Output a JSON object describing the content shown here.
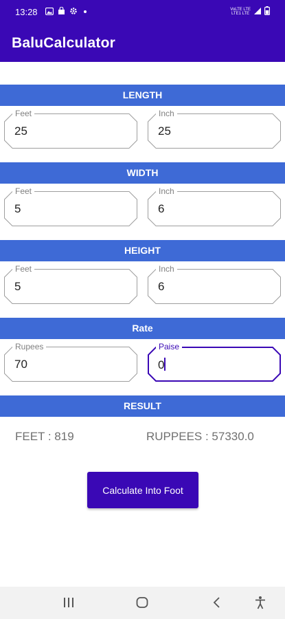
{
  "status_bar": {
    "time": "13:28",
    "net_line1": "VoLTE LTE",
    "net_line2": "LTE1 LTE",
    "icons": [
      "image-icon",
      "bag-icon",
      "gear-icon",
      "dot-icon",
      "signal-icon",
      "battery-icon"
    ]
  },
  "app_bar": {
    "title": "BaluCalculator"
  },
  "sections": {
    "length": "LENGTH",
    "width": "WIDTH",
    "height": "HEIGHT",
    "rate": "Rate",
    "result": "RESULT"
  },
  "length": {
    "feet": {
      "label": "Feet",
      "value": "25"
    },
    "inch": {
      "label": "Inch",
      "value": "25"
    }
  },
  "width": {
    "feet": {
      "label": "Feet",
      "value": "5"
    },
    "inch": {
      "label": "Inch",
      "value": "6"
    }
  },
  "height": {
    "feet": {
      "label": "Feet",
      "value": "5"
    },
    "inch": {
      "label": "Inch",
      "value": "6"
    }
  },
  "rate": {
    "rupees": {
      "label": "Rupees",
      "value": "70"
    },
    "paise": {
      "label": "Paise",
      "value": "0"
    }
  },
  "result": {
    "feet": "FEET : 819",
    "rupees": "RUPPEES : 57330.0"
  },
  "button": {
    "label": "Calculate Into Foot"
  },
  "colors": {
    "primary": "#3a08b5",
    "section": "#3e6ad6",
    "outline": "#9e9e9e"
  }
}
